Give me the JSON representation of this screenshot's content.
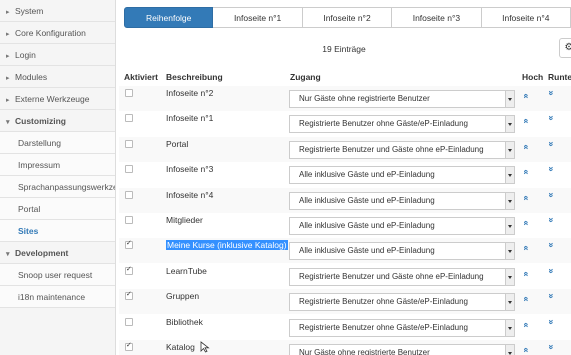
{
  "sidebar": {
    "items": [
      {
        "label": "System",
        "kind": "collapsed"
      },
      {
        "label": "Core Konfiguration",
        "kind": "collapsed"
      },
      {
        "label": "Login",
        "kind": "collapsed"
      },
      {
        "label": "Modules",
        "kind": "collapsed"
      },
      {
        "label": "Externe Werkzeuge",
        "kind": "collapsed"
      },
      {
        "label": "Customizing",
        "kind": "expanded"
      },
      {
        "label": "Darstellung",
        "kind": "sub"
      },
      {
        "label": "Impressum",
        "kind": "sub"
      },
      {
        "label": "Sprachanpassungswerkzeug",
        "kind": "sub"
      },
      {
        "label": "Portal",
        "kind": "sub"
      },
      {
        "label": "Sites",
        "kind": "sub-active"
      },
      {
        "label": "Development",
        "kind": "expanded"
      },
      {
        "label": "Snoop user request",
        "kind": "sub"
      },
      {
        "label": "i18n maintenance",
        "kind": "sub"
      }
    ]
  },
  "tabs": [
    {
      "label": "Reihenfolge",
      "active": true
    },
    {
      "label": "Infoseite n°1",
      "active": false
    },
    {
      "label": "Infoseite n°2",
      "active": false
    },
    {
      "label": "Infoseite n°3",
      "active": false
    },
    {
      "label": "Infoseite n°4",
      "active": false
    }
  ],
  "entry_count": "19 Einträge",
  "columns": {
    "aktiviert": "Aktiviert",
    "beschreibung": "Beschreibung",
    "zugang": "Zugang",
    "hoch": "Hoch",
    "runter": "Runter"
  },
  "rows": [
    {
      "checked": false,
      "desc": "Infoseite n°2",
      "access": "Nur Gäste ohne registrierte Benutzer",
      "selected": false
    },
    {
      "checked": false,
      "desc": "Infoseite n°1",
      "access": "Registrierte Benutzer ohne Gäste/eP-Einladung",
      "selected": false
    },
    {
      "checked": false,
      "desc": "Portal",
      "access": "Registrierte Benutzer und Gäste ohne eP-Einladung",
      "selected": false
    },
    {
      "checked": false,
      "desc": "Infoseite n°3",
      "access": "Alle inklusive Gäste und eP-Einladung",
      "selected": false
    },
    {
      "checked": false,
      "desc": "Infoseite n°4",
      "access": "Alle inklusive Gäste und eP-Einladung",
      "selected": false
    },
    {
      "checked": false,
      "desc": "Mitglieder",
      "access": "Alle inklusive Gäste und eP-Einladung",
      "selected": false
    },
    {
      "checked": true,
      "desc": "Meine Kurse (inklusive Katalog)",
      "access": "Alle inklusive Gäste und eP-Einladung",
      "selected": true
    },
    {
      "checked": true,
      "desc": "LearnTube",
      "access": "Registrierte Benutzer und Gäste ohne eP-Einladung",
      "selected": false
    },
    {
      "checked": true,
      "desc": "Gruppen",
      "access": "Registrierte Benutzer ohne Gäste/eP-Einladung",
      "selected": false
    },
    {
      "checked": false,
      "desc": "Bibliothek",
      "access": "Registrierte Benutzer ohne Gäste/eP-Einladung",
      "selected": false
    },
    {
      "checked": true,
      "desc": "Katalog",
      "access": "Nur Gäste ohne registrierte Benutzer",
      "selected": false
    }
  ],
  "icons": {
    "collapsed": "caret-right-icon",
    "expanded": "caret-down-icon",
    "up": "double-chevron-up-icon",
    "down": "double-chevron-down-icon",
    "settings": "gear-icon"
  },
  "colors": {
    "accent": "#337ab7",
    "selection": "#3390ff"
  }
}
